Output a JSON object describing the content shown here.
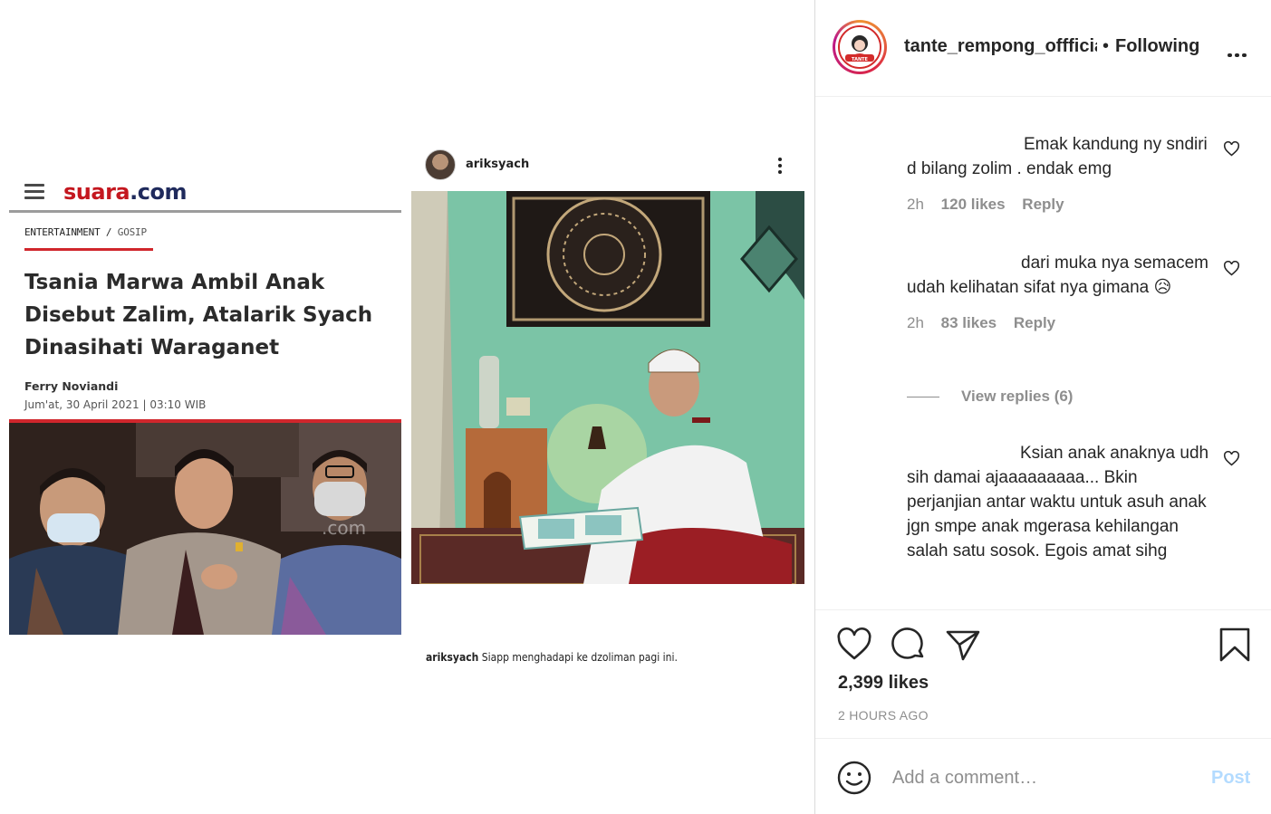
{
  "post": {
    "article": {
      "logo_text": "suara",
      "logo_dot": ".com",
      "category": "Entertainment",
      "category_sep": " / ",
      "subcategory": "Gosip",
      "headline": "Tsania Marwa Ambil Anak Disebut Zalim, Atalarik Syach Dinasihati Waraganet",
      "author": "Ferry Noviandi",
      "date": "Jum'at, 30 April 2021 | 03:10 WIB",
      "watermark": ".com"
    },
    "inner_post": {
      "username": "ariksyach",
      "caption_user": "ariksyach",
      "caption_text": " Siapp menghadapi ke dzoliman pagi ini."
    }
  },
  "header": {
    "username": "tante_rempong_offficial",
    "separator": "•",
    "follow_status": "Following",
    "avatar_text": "TANTE"
  },
  "comments": [
    {
      "text": "Emak kandung ny sndiri d bilang zolim . endak emg",
      "time": "2h",
      "likes": "120 likes",
      "reply": "Reply"
    },
    {
      "text": "dari muka nya semacem udah kelihatan sifat nya gimana 😥",
      "time": "2h",
      "likes": "83 likes",
      "reply": "Reply"
    },
    {
      "text": "Ksian anak anaknya udh sih damai ajaaaaaaaaa... Bkin perjanjian antar waktu untuk asuh anak jgn smpe anak mgerasa kehilangan salah satu sosok. Egois amat sihg"
    }
  ],
  "view_replies": "View replies (6)",
  "actions": {
    "likes": "2,399 likes",
    "time_ago": "2 HOURS AGO"
  },
  "add_comment": {
    "placeholder": "Add a comment…",
    "post_label": "Post"
  },
  "colors": {
    "suara_red": "#c4171f",
    "suara_navy": "#1f2a5c",
    "post_button_disabled": "#b3dbff",
    "meta_gray": "#8e8e8e"
  }
}
